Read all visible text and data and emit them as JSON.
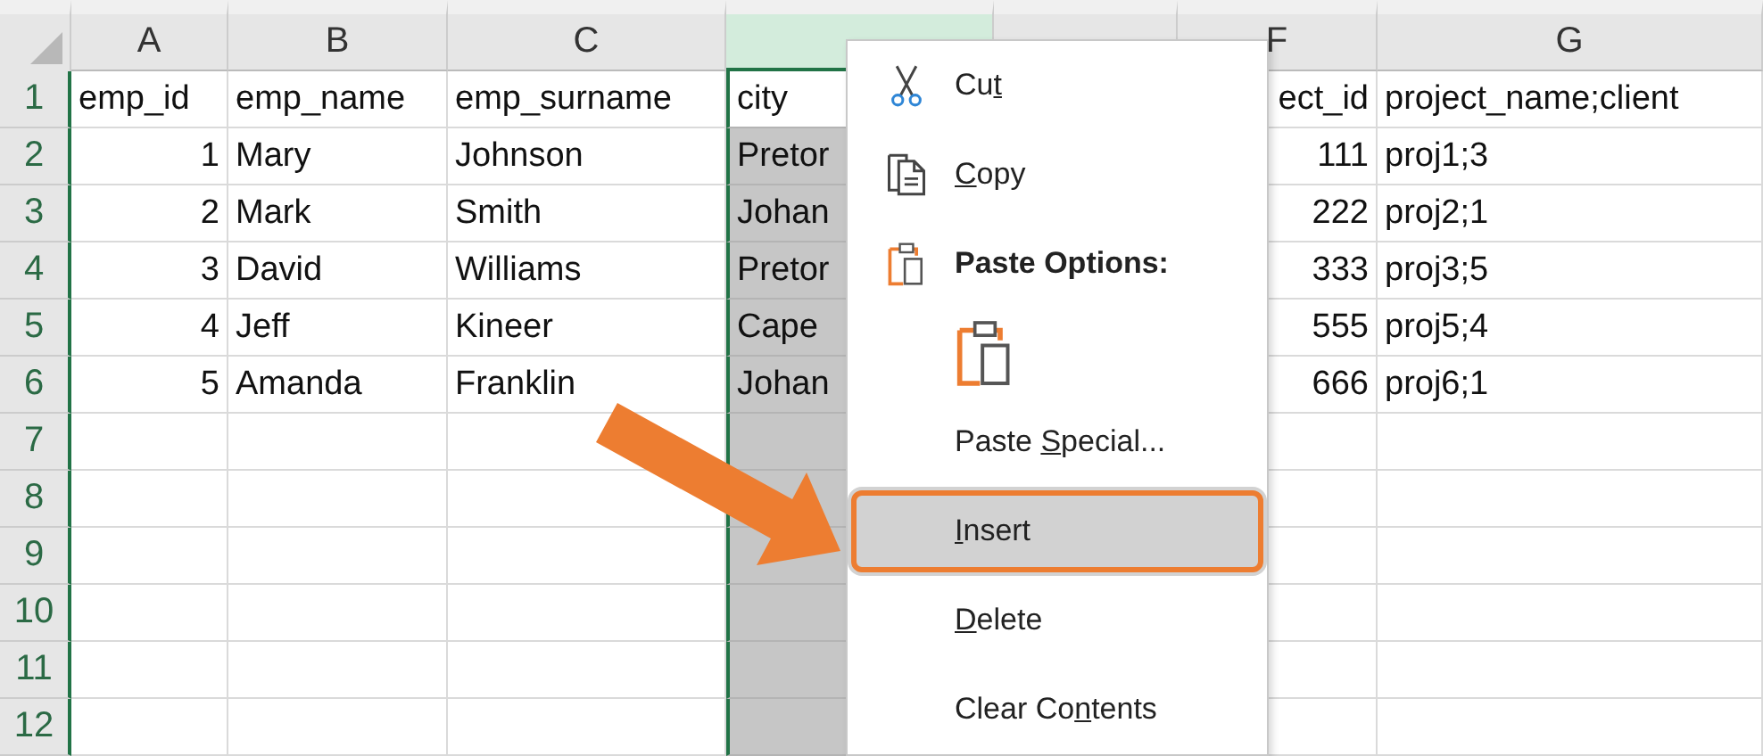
{
  "columns": [
    {
      "label": "A",
      "selected": false
    },
    {
      "label": "B",
      "selected": false
    },
    {
      "label": "C",
      "selected": false
    },
    {
      "selected": true
    },
    {
      "selected": false
    },
    {
      "label": "F",
      "selected": false
    },
    {
      "label": "G",
      "selected": false
    }
  ],
  "rows": [
    {
      "number": "1",
      "cells": [
        {
          "text": "emp_id",
          "kind": "text"
        },
        {
          "text": "emp_name",
          "kind": "text"
        },
        {
          "text": "emp_surname",
          "kind": "text"
        },
        {
          "text": "city",
          "kind": "text",
          "active": true
        },
        null,
        {
          "text": "ect_id",
          "kind": "cut-text"
        },
        {
          "text": "project_name;client",
          "kind": "text"
        }
      ]
    },
    {
      "number": "2",
      "cells": [
        {
          "text": "1",
          "kind": "number"
        },
        {
          "text": "Mary",
          "kind": "text"
        },
        {
          "text": "Johnson",
          "kind": "text"
        },
        {
          "text": "Pretor",
          "kind": "text",
          "active": false
        },
        null,
        {
          "text": "111",
          "kind": "number"
        },
        {
          "text": "proj1;3",
          "kind": "text"
        }
      ]
    },
    {
      "number": "3",
      "cells": [
        {
          "text": "2",
          "kind": "number"
        },
        {
          "text": "Mark",
          "kind": "text"
        },
        {
          "text": "Smith",
          "kind": "text"
        },
        {
          "text": "Johan",
          "kind": "text",
          "active": false
        },
        null,
        {
          "text": "222",
          "kind": "number"
        },
        {
          "text": "proj2;1",
          "kind": "text"
        }
      ]
    },
    {
      "number": "4",
      "cells": [
        {
          "text": "3",
          "kind": "number"
        },
        {
          "text": "David",
          "kind": "text"
        },
        {
          "text": "Williams",
          "kind": "text"
        },
        {
          "text": "Pretor",
          "kind": "text",
          "active": false
        },
        null,
        {
          "text": "333",
          "kind": "number"
        },
        {
          "text": "proj3;5",
          "kind": "text"
        }
      ]
    },
    {
      "number": "5",
      "cells": [
        {
          "text": "4",
          "kind": "number"
        },
        {
          "text": "Jeff",
          "kind": "text"
        },
        {
          "text": "Kineer",
          "kind": "text"
        },
        {
          "text": "Cape",
          "kind": "text",
          "active": false
        },
        null,
        {
          "text": "555",
          "kind": "number"
        },
        {
          "text": "proj5;4",
          "kind": "text"
        }
      ]
    },
    {
      "number": "6",
      "cells": [
        {
          "text": "5",
          "kind": "number"
        },
        {
          "text": "Amanda",
          "kind": "text"
        },
        {
          "text": "Franklin",
          "kind": "text"
        },
        {
          "text": "Johan",
          "kind": "text",
          "active": false
        },
        null,
        {
          "text": "666",
          "kind": "number"
        },
        {
          "text": "proj6;1",
          "kind": "text"
        }
      ]
    },
    {
      "number": "7"
    },
    {
      "number": "8"
    },
    {
      "number": "9"
    },
    {
      "number": "10"
    },
    {
      "number": "11"
    },
    {
      "number": "12"
    }
  ],
  "context_menu": {
    "items": [
      {
        "kind": "command",
        "label_parts": [
          {
            "text": "Cu",
            "underlined": false
          },
          {
            "text": "t",
            "underlined": true
          }
        ],
        "selected": false,
        "highlighted": false
      },
      {
        "kind": "command",
        "label_parts": [
          {
            "text": "C",
            "underlined": true
          },
          {
            "text": "opy",
            "underlined": false
          }
        ],
        "selected": false,
        "highlighted": false
      },
      {
        "kind": "heading",
        "label": "Paste Options:"
      },
      {
        "kind": "paste-option"
      },
      {
        "kind": "command",
        "label_parts": [
          {
            "text": "Paste ",
            "underlined": false
          },
          {
            "text": "S",
            "underlined": true
          },
          {
            "text": "pecial...",
            "underlined": false
          }
        ],
        "selected": false,
        "highlighted": false
      },
      {
        "kind": "command",
        "label_parts": [
          {
            "text": "I",
            "underlined": true
          },
          {
            "text": "nsert",
            "underlined": false
          }
        ],
        "selected": true,
        "highlighted": true
      },
      {
        "kind": "command",
        "label_parts": [
          {
            "text": "D",
            "underlined": true
          },
          {
            "text": "elete",
            "underlined": false
          }
        ],
        "selected": false,
        "highlighted": false
      },
      {
        "kind": "command",
        "label_parts": [
          {
            "text": "Clear Co",
            "underlined": false
          },
          {
            "text": "n",
            "underlined": true
          },
          {
            "text": "tents",
            "underlined": false
          }
        ],
        "selected": false,
        "highlighted": false
      }
    ]
  }
}
